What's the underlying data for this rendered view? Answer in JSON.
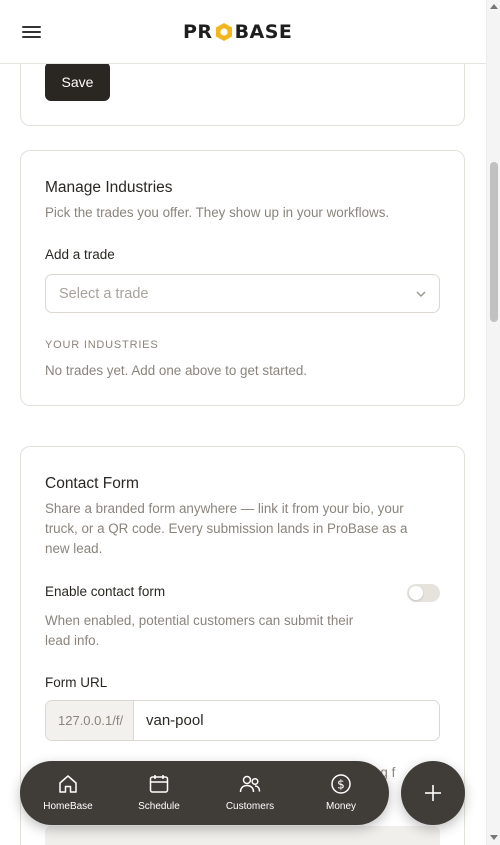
{
  "header": {
    "logo_left": "PR",
    "logo_right": "BASE"
  },
  "save_card": {
    "save_label": "Save"
  },
  "industries": {
    "title": "Manage Industries",
    "description": "Pick the trades you offer. They show up in your workflows.",
    "add_label": "Add a trade",
    "select_placeholder": "Select a trade",
    "list_heading": "YOUR INDUSTRIES",
    "empty_text": "No trades yet. Add one above to get started."
  },
  "contact_form": {
    "title": "Contact Form",
    "description_lines": [
      "Share a branded form anywhere — link it from your bio, your",
      "truck, or a QR code. Every submission lands in ProBase as a",
      "new lead."
    ],
    "enable_label": "Enable contact form",
    "enable_on": false,
    "enable_help_lines": [
      "When enabled, potential customers can submit their",
      "lead info."
    ],
    "url_label": "Form URL",
    "url_prefix": "127.0.0.1/f/",
    "url_slug": "van-pool",
    "partial_text": "ing f"
  },
  "bottom_nav": {
    "items": [
      {
        "label": "HomeBase",
        "icon": "home-icon"
      },
      {
        "label": "Schedule",
        "icon": "calendar-icon"
      },
      {
        "label": "Customers",
        "icon": "users-icon"
      },
      {
        "label": "Money",
        "icon": "dollar-icon"
      }
    ],
    "fab_icon": "plus-icon"
  },
  "colors": {
    "brand_dark": "#2a2723",
    "nav_bg": "#403d39",
    "logo_accent": "#f2b51b"
  }
}
